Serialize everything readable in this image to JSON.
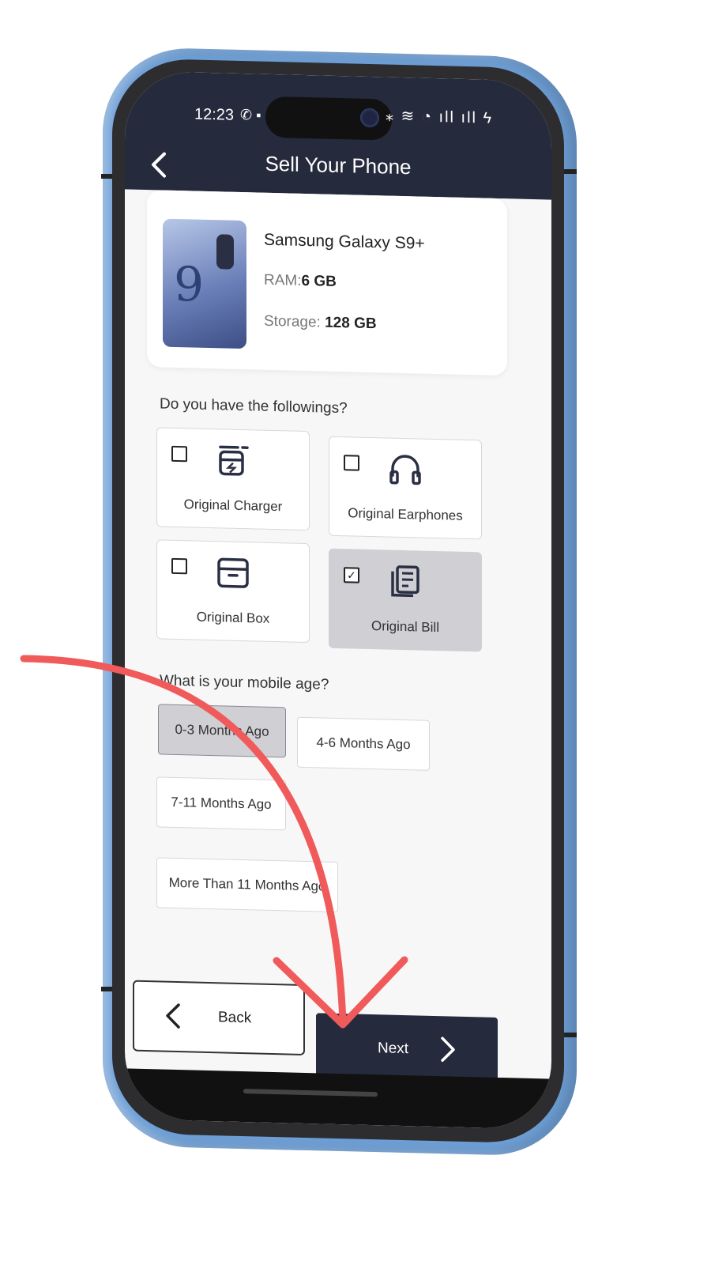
{
  "status_bar": {
    "time": "12:23",
    "left_icons": "✆ ▪",
    "right_icons": "⁎ ≋ ◔ ıll ıll ϟ"
  },
  "header": {
    "title": "Sell Your Phone"
  },
  "product": {
    "name": "Samsung Galaxy S9+",
    "ram_label": "RAM:",
    "ram_value": "6 GB",
    "storage_label": "Storage:",
    "storage_value": "128 GB",
    "image_glyph": "9"
  },
  "accessories": {
    "question": "Do you have the followings?",
    "items": [
      {
        "label": "Original Charger",
        "icon": "charger-icon",
        "checked": false
      },
      {
        "label": "Original Earphones",
        "icon": "headphones-icon",
        "checked": false
      },
      {
        "label": "Original Box",
        "icon": "box-icon",
        "checked": false
      },
      {
        "label": "Original Bill",
        "icon": "bill-icon",
        "checked": true
      }
    ]
  },
  "age": {
    "question": "What is your mobile age?",
    "options": [
      {
        "label": "0-3 Months Ago",
        "selected": true
      },
      {
        "label": "4-6 Months Ago",
        "selected": false
      },
      {
        "label": "7-11 Months Ago",
        "selected": false
      },
      {
        "label": "More Than 11 Months Ago",
        "selected": false
      }
    ]
  },
  "footer": {
    "back_label": "Back",
    "next_label": "Next"
  },
  "colors": {
    "header_bg": "#262a3d",
    "phone_frame": "#6e9fd6",
    "selected_bg": "#cfcfd4",
    "annotation_arrow": "#f05a5a"
  }
}
